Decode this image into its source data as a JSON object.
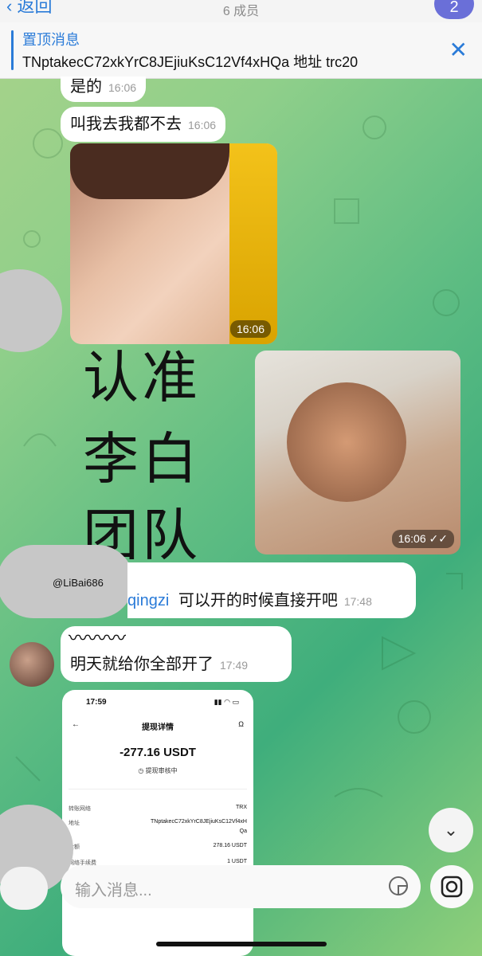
{
  "header": {
    "back_label": "返回",
    "members_label": "6 成员",
    "badge_count": "2"
  },
  "pinned": {
    "title": "置顶消息",
    "text": "TNptakecC72xkYrC8JEjiuKsC12Vf4xHQa 地址 trc20"
  },
  "messages": [
    {
      "text": "是的",
      "time": "16:06"
    },
    {
      "text": "叫我去我都不去",
      "time": "16:06"
    },
    {
      "photo_time": "16:06"
    },
    {
      "photo_time": "16:06"
    },
    {
      "mention": "qingzi",
      "text": "可以开的时候直接开吧",
      "time": "17:48"
    },
    {
      "text": "明天就给你全部开了",
      "time": "17:49"
    }
  ],
  "overlay_text": {
    "line1": "认准",
    "line2": "李白",
    "line3": "团队",
    "handle": "@LiBai686"
  },
  "screenshot": {
    "status_time": "17:59",
    "title": "提现详情",
    "amount": "-277.16 USDT",
    "status": "提现审核中",
    "rows": [
      {
        "label": "转账网络",
        "value": "TRX"
      },
      {
        "label": "地址",
        "value": "TNptakecC72xkYrC8JEjiuKsC12Vf4xH"
      },
      {
        "label": "",
        "value": "Qa"
      },
      {
        "label": "金额",
        "value": "278.16 USDT"
      },
      {
        "label": "网络手续费",
        "value": "1 USDT"
      }
    ]
  },
  "input": {
    "placeholder": "输入消息..."
  },
  "colors": {
    "accent": "#2a7bd8",
    "bubble": "#ffffff",
    "badge": "#6a6fd8"
  }
}
